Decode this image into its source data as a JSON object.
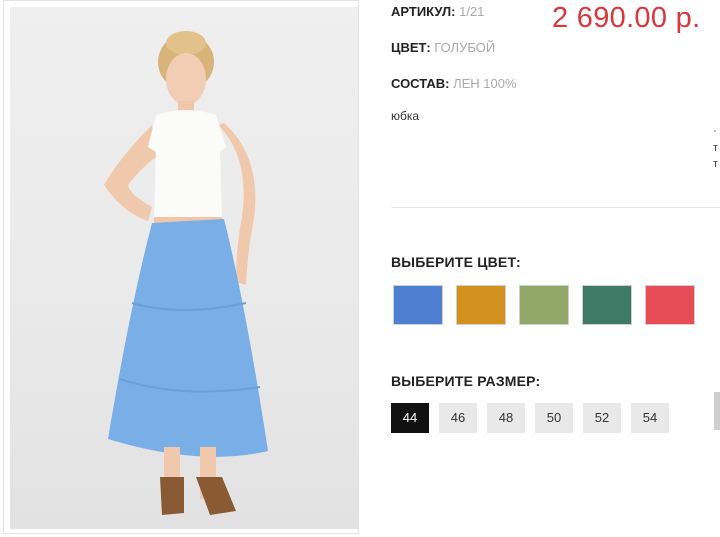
{
  "product": {
    "photo_alt": "",
    "sku_label": "АРТИКУЛ:",
    "sku_value": "1/21",
    "color_label": "ЦВЕТ:",
    "color_value": "ГОЛУБОЙ",
    "material_label": "СОСТАВ:",
    "material_value": "ЛЕН 100%",
    "description": "юбка",
    "price": "2 690.00 р."
  },
  "color_picker": {
    "title": "ВЫБЕРИТЕ ЦВЕТ:",
    "swatches": [
      {
        "name": "blue",
        "hex": "#4e7fd0"
      },
      {
        "name": "mustard",
        "hex": "#d3921d"
      },
      {
        "name": "sage",
        "hex": "#92a869"
      },
      {
        "name": "teal",
        "hex": "#3e7a66"
      },
      {
        "name": "coral",
        "hex": "#e84d57"
      }
    ]
  },
  "size_picker": {
    "title": "ВЫБЕРИТЕ РАЗМЕР:",
    "sizes": [
      "44",
      "46",
      "48",
      "50",
      "52",
      "54"
    ],
    "selected": "44"
  },
  "colors": {
    "price": "#d9363e",
    "selected_size_bg": "#111111"
  }
}
